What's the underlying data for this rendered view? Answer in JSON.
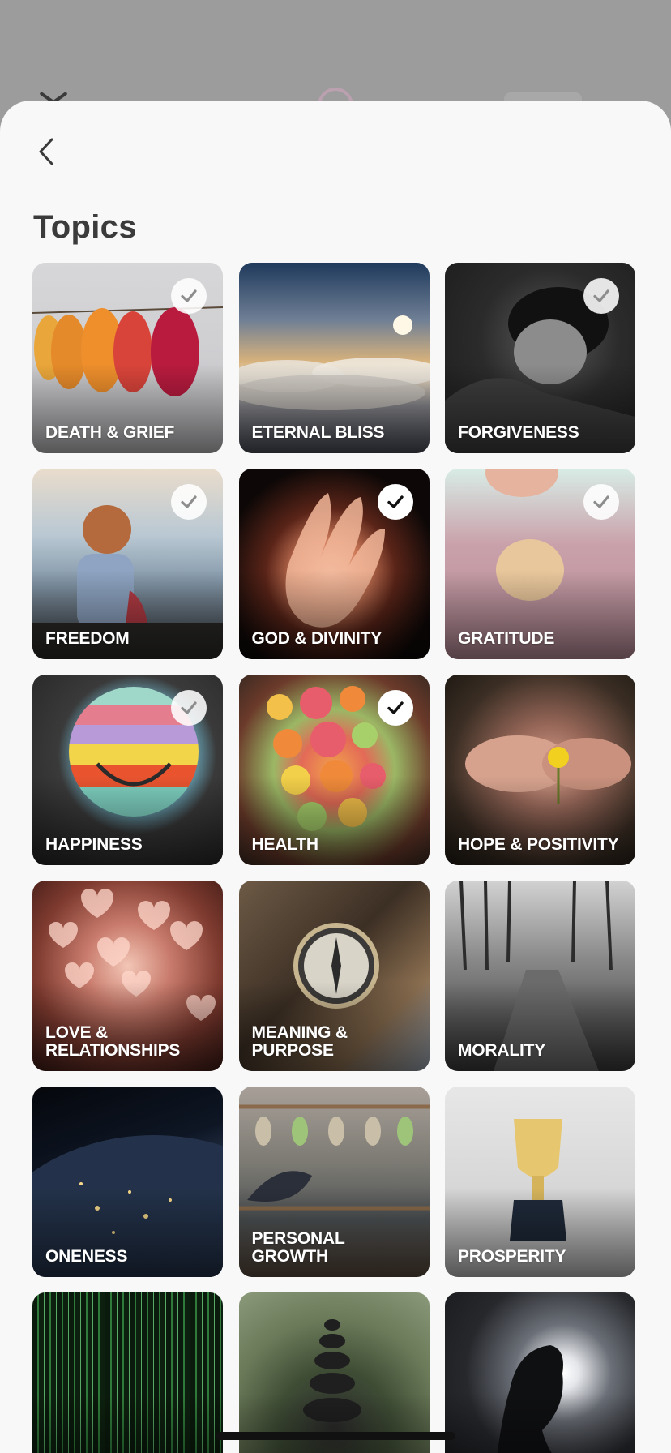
{
  "screen": {
    "title": "Topics"
  },
  "icons": {
    "back": "chevron-left-icon",
    "check": "checkmark-icon"
  },
  "colors": {
    "sheet": "#f8f8f8",
    "title": "#3b3b3b",
    "check_bg": "#ffffff"
  },
  "topics": [
    {
      "label": "DEATH & GRIEF",
      "checked": true,
      "check_style": "soft"
    },
    {
      "label": "ETERNAL BLISS",
      "checked": false
    },
    {
      "label": "FORGIVENESS",
      "checked": true,
      "check_style": "soft"
    },
    {
      "label": "FREEDOM",
      "checked": true,
      "check_style": "soft"
    },
    {
      "label": "GOD & DIVINITY",
      "checked": true,
      "check_style": "solid"
    },
    {
      "label": "GRATITUDE",
      "checked": true,
      "check_style": "soft"
    },
    {
      "label": "HAPPINESS",
      "checked": true,
      "check_style": "soft"
    },
    {
      "label": "HEALTH",
      "checked": true,
      "check_style": "solid"
    },
    {
      "label": "HOPE & POSITIVITY",
      "checked": false
    },
    {
      "label": "LOVE & RELATIONSHIPS",
      "checked": false
    },
    {
      "label": "MEANING & PURPOSE",
      "checked": false
    },
    {
      "label": "MORALITY",
      "checked": false
    },
    {
      "label": "ONENESS",
      "checked": false
    },
    {
      "label": "PERSONAL GROWTH",
      "checked": false
    },
    {
      "label": "PROSPERITY",
      "checked": false
    },
    {
      "label": "",
      "checked": false
    },
    {
      "label": "",
      "checked": false
    },
    {
      "label": "",
      "checked": false
    }
  ]
}
